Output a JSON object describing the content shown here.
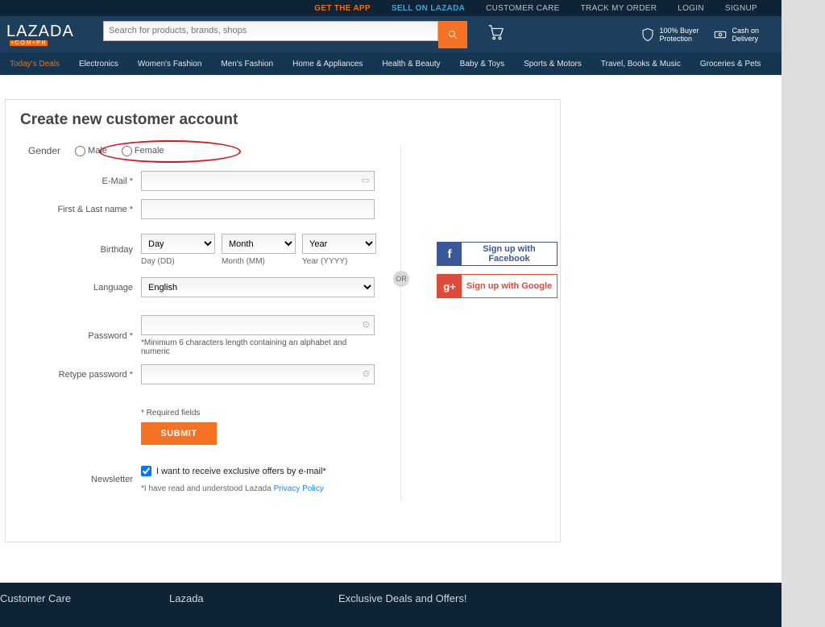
{
  "topbar": {
    "app": "GET THE APP",
    "sell": "SELL ON LAZADA",
    "care": "CUSTOMER CARE",
    "track": "TRACK MY ORDER",
    "login": "LOGIN",
    "signup": "SIGNUP"
  },
  "logo": {
    "text": "LAZADA",
    "sub": "• C O M • P H"
  },
  "search": {
    "placeholder": "Search for products, brands, shops"
  },
  "trust": {
    "buyer1": "100% Buyer",
    "buyer2": "Protection",
    "cod1": "Cash on",
    "cod2": "Delivery"
  },
  "nav": [
    "Today's Deals",
    "Electronics",
    "Women's Fashion",
    "Men's Fashion",
    "Home & Appliances",
    "Health & Beauty",
    "Baby & Toys",
    "Sports & Motors",
    "Travel, Books & Music",
    "Groceries & Pets"
  ],
  "form": {
    "title": "Create new customer account",
    "labels": {
      "gender": "Gender",
      "male": "Male",
      "female": "Female",
      "email": "E-Mail *",
      "name": "First & Last name *",
      "birthday": "Birthday",
      "language": "Language",
      "password": "Password *",
      "retype": "Retype password *",
      "newsletter": "Newsletter"
    },
    "birthday": {
      "day": "Day",
      "month": "Month",
      "year": "Year",
      "dayhint": "Day (DD)",
      "monthhint": "Month (MM)",
      "yearhint": "Year (YYYY)"
    },
    "language_value": "English",
    "password_hint": "*Minimum 6 characters length containing an alphabet and numeric",
    "required": "* Required fields",
    "submit": "SUBMIT",
    "newsletter_cb": "I want to receive exclusive offers by e-mail*",
    "policy_prefix": "*I have read and understood Lazada ",
    "policy_link": "Privacy Policy",
    "or": "OR",
    "facebook": "Sign up with Facebook",
    "google": "Sign up with Google"
  },
  "footer": {
    "c1": "Customer Care",
    "c2": "Lazada",
    "c3": "Exclusive Deals and Offers!"
  }
}
